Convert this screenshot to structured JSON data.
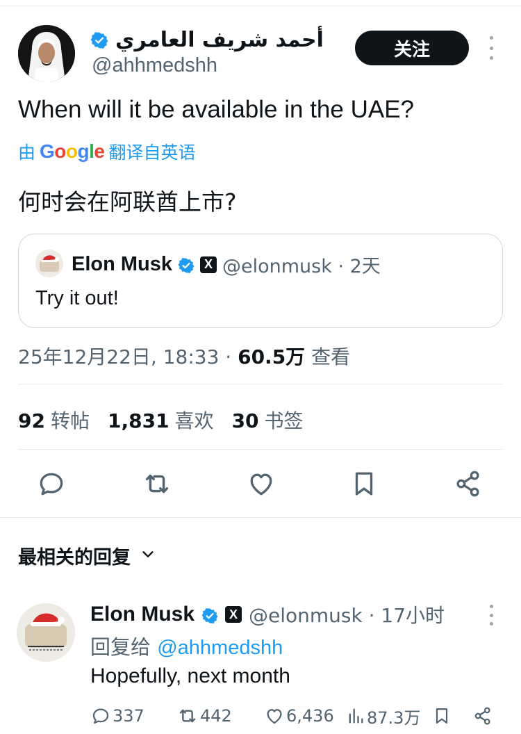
{
  "tweet": {
    "author": {
      "display_name": "أحمد شريف العامري",
      "handle": "@ahhmedshh",
      "verified": true
    },
    "follow_label": "关注",
    "text": "When will it be available in the UAE?",
    "translation": {
      "prefix": "由",
      "provider": "Google",
      "suffix": "翻译自英语",
      "text": "何时会在阿联酋上市?"
    },
    "quote": {
      "display_name": "Elon Musk",
      "handle_time": "@elonmusk · 2天",
      "text": "Try it out!"
    },
    "meta": {
      "datetime": "25年12月22日, 18:33 · ",
      "views_count": "60.5万",
      "views_label": " 查看"
    },
    "stats": {
      "reposts": {
        "count": "92",
        "label": "转帖"
      },
      "likes": {
        "count": "1,831",
        "label": "喜欢"
      },
      "bookmarks": {
        "count": "30",
        "label": "书签"
      }
    }
  },
  "replies_sort_label": "最相关的回复",
  "reply": {
    "display_name": "Elon Musk",
    "handle_time": "@elonmusk · 17小时",
    "reply_to_label": "回复给 ",
    "reply_to_handle": "@ahhmedshh",
    "text": "Hopefully, next month",
    "counts": {
      "replies": "337",
      "reposts": "442",
      "likes": "6,436",
      "views": "87.3万"
    }
  },
  "icons": {
    "verified": "verified-badge-icon",
    "affiliate": "x-logo-icon",
    "reply": "reply-bubble-icon",
    "repost": "repost-icon",
    "like": "heart-icon",
    "bookmark": "bookmark-icon",
    "share": "share-icon",
    "views": "views-bar-icon",
    "more": "more-dots-icon",
    "chevron": "chevron-down-icon"
  },
  "colors": {
    "accent": "#1d9bf0",
    "text": "#0f1419",
    "muted": "#536471",
    "border": "#cfd9de"
  }
}
